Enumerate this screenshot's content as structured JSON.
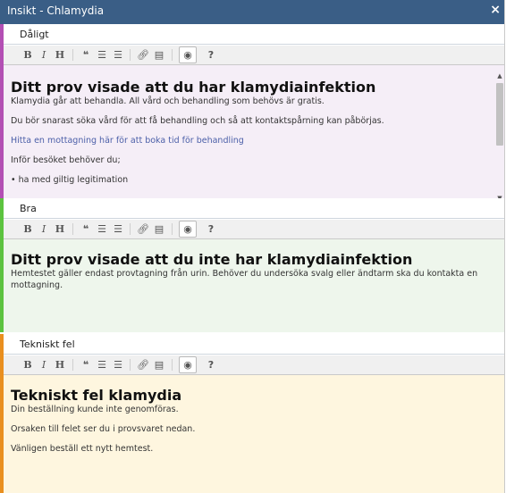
{
  "dialog": {
    "title": "Insikt - Chlamydia",
    "close_label": "×"
  },
  "toolbar": [
    "B",
    "I",
    "H",
    "❝",
    "≡",
    "≡",
    "🔗",
    "🗎",
    "👁",
    "?"
  ],
  "sections": [
    {
      "label": "Dåligt",
      "accent": "#b34fb4",
      "bg": "#f5eef7",
      "heading": "Ditt prov visade att du har klamydiainfektion",
      "paragraphs": [
        "Klamydia går att behandla. All vård och behandling som behövs är gratis.",
        "Du bör snarast söka vård för att få behandling och så att kontaktspårning kan påbörjas.",
        "Hitta en mottagning här för att boka tid för behandling",
        "Inför besöket behöver du;",
        "• ha med giltig legitimation"
      ]
    },
    {
      "label": "Bra",
      "accent": "#5cc33f",
      "bg": "#eef6ec",
      "heading": "Ditt prov visade att du inte har klamydiainfektion",
      "paragraphs": [
        "Hemtestet gäller endast provtagning från urin. Behöver du undersöka svalg eller ändtarm ska du kontakta en mottagning."
      ]
    },
    {
      "label": "Tekniskt fel",
      "accent": "#e98f1f",
      "bg": "#fef6df",
      "heading": "Tekniskt fel klamydia",
      "paragraphs": [
        "Din beställning kunde inte genomföras.",
        "Orsaken till felet ser du i provsvaret nedan.",
        "Vänligen beställ ett nytt hemtest."
      ]
    }
  ]
}
